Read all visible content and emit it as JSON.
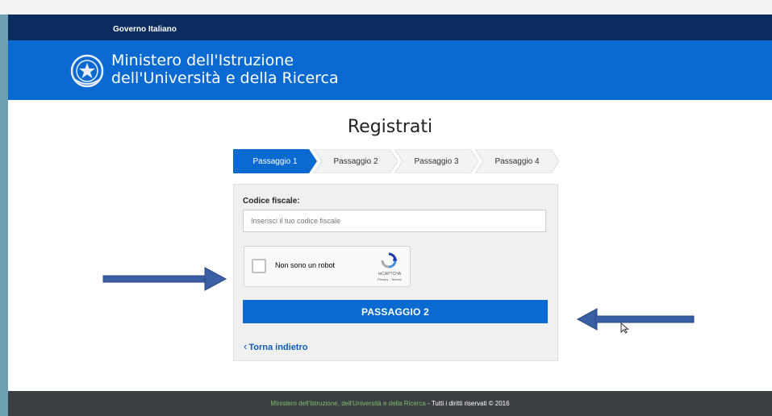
{
  "gov_bar": {
    "label": "Governo Italiano"
  },
  "header": {
    "title_line1": "Ministero dell'Istruzione",
    "title_line2": "dell'Università e della Ricerca"
  },
  "page": {
    "title": "Registrati"
  },
  "steps": [
    {
      "label": "Passaggio 1",
      "active": true
    },
    {
      "label": "Passaggio 2",
      "active": false
    },
    {
      "label": "Passaggio 3",
      "active": false
    },
    {
      "label": "Passaggio 4",
      "active": false
    }
  ],
  "form": {
    "cf_label": "Codice fiscale:",
    "cf_placeholder": "Inserisci il tuo codice fiscale",
    "cf_value": "",
    "captcha": {
      "label": "Non sono un robot",
      "brand": "reCAPTCHA",
      "links": "Privacy - Termini"
    },
    "next_label": "PASSAGGIO 2",
    "back_label": "Torna indietro"
  },
  "footer": {
    "link_text": "Ministero dell'Istruzione, dell'Università e della Ricerca",
    "rights_text": " - Tutti i diritti riservati © 2016"
  },
  "colors": {
    "gov_bar": "#0a2c5e",
    "header": "#0b6ad2",
    "accent": "#0b6ad2",
    "footer": "#3b3e42",
    "annotation_arrow": "#3b5fa5"
  }
}
